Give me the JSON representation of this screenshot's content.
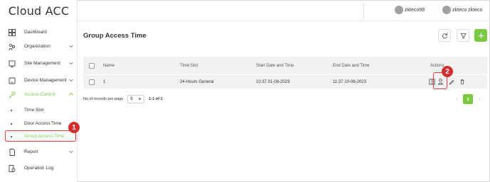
{
  "app": {
    "title": "Cloud ACC"
  },
  "colors": {
    "accent": "#7ac943",
    "highlight": "#e53935",
    "badge": "#d32f2f"
  },
  "sidebar": {
    "items": [
      {
        "label": "Dashboard",
        "icon": "dashboard-icon"
      },
      {
        "label": "Organization",
        "icon": "organization-icon"
      },
      {
        "label": "Site Management",
        "icon": "site-icon"
      },
      {
        "label": "Device Management",
        "icon": "device-icon"
      },
      {
        "label": "Access Control",
        "icon": "access-control-icon"
      },
      {
        "label": "Report",
        "icon": "report-icon"
      },
      {
        "label": "Operation Log",
        "icon": "operation-log-icon"
      }
    ],
    "sub_items": [
      {
        "label": "Time Slot"
      },
      {
        "label": "Door Access Time"
      },
      {
        "label": "Group Access Time"
      }
    ]
  },
  "header": {
    "users": [
      {
        "name": "zkteco99"
      },
      {
        "name": "zkteco zkteco"
      }
    ]
  },
  "main": {
    "title": "Group Access Time",
    "columns": [
      "Name",
      "Time Slot",
      "Start Date and Time",
      "End Date and Time",
      "Actions"
    ],
    "rows": [
      {
        "name": "1",
        "time_slot": "24-Hours General",
        "start": "10:37 01-08-2023",
        "end": "11:37 10-08-2023"
      }
    ],
    "footer": {
      "records_label": "No.of records per page",
      "per_page": "8",
      "range": "1-1 of 1"
    },
    "pager": {
      "current": "1"
    }
  },
  "annotations": {
    "step1": "1",
    "step2": "2"
  }
}
